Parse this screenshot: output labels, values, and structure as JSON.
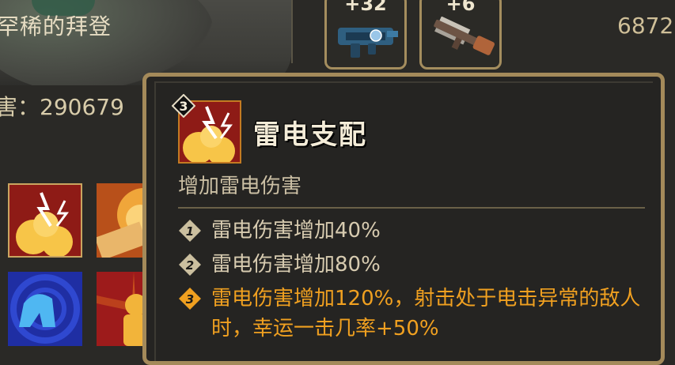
{
  "header": {
    "enemy_name": "罕稀的拜登",
    "top_right_value": "6872"
  },
  "stats": {
    "damage_line": "害：290679"
  },
  "weapons": [
    {
      "level_label": "+32",
      "icon": "smg-weapon-icon"
    },
    {
      "level_label": "+6",
      "icon": "rifle-weapon-icon"
    }
  ],
  "skills": [
    {
      "icon": "lightning-skill-icon",
      "selected": true
    },
    {
      "icon": "explosion-skill-icon"
    },
    {
      "icon": "blue-spiral-skill-icon"
    },
    {
      "icon": "fire-figure-skill-icon"
    }
  ],
  "tooltip": {
    "rank": "3",
    "title": "雷电支配",
    "description": "增加雷电伤害",
    "levels": [
      {
        "badge": "1",
        "text": "雷电伤害增加40%",
        "active": false
      },
      {
        "badge": "2",
        "text": "雷电伤害增加80%",
        "active": false
      },
      {
        "badge": "3",
        "text": "雷电伤害增加120%，射击处于电击异常的敌人时，幸运一击几率+50%",
        "active": true
      }
    ]
  },
  "colors": {
    "active_text": "#f0a020",
    "frame_gold": "#a48a5a",
    "panel_bg": "#252422"
  }
}
